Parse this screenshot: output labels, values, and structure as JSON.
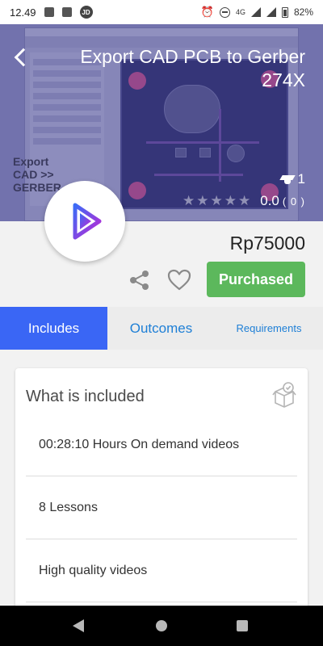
{
  "status_bar": {
    "time": "12.49",
    "network": "4G",
    "battery": "82%"
  },
  "hero": {
    "title": "Export CAD PCB to Gerber 274X",
    "thumbnail_text": "Export\nCAD >>\nGERBER",
    "enrollments": "1",
    "rating_value": "0.0",
    "rating_count": "( 0 )",
    "stars_filled": 0,
    "stars_total": 5
  },
  "course": {
    "price": "Rp75000",
    "purchase_label": "Purchased"
  },
  "tabs": [
    {
      "label": "Includes",
      "active": true
    },
    {
      "label": "Outcomes",
      "active": false
    },
    {
      "label": "Requirements",
      "active": false
    }
  ],
  "includes": {
    "title": "What is included",
    "items": [
      "00:28:10 Hours On demand videos",
      "8 Lessons",
      "High quality videos"
    ]
  },
  "colors": {
    "accent_blue": "#3a66f5",
    "link_blue": "#1e7fd6",
    "purchased_green": "#5cb85c",
    "hero_tint": "#6e6ea6"
  }
}
